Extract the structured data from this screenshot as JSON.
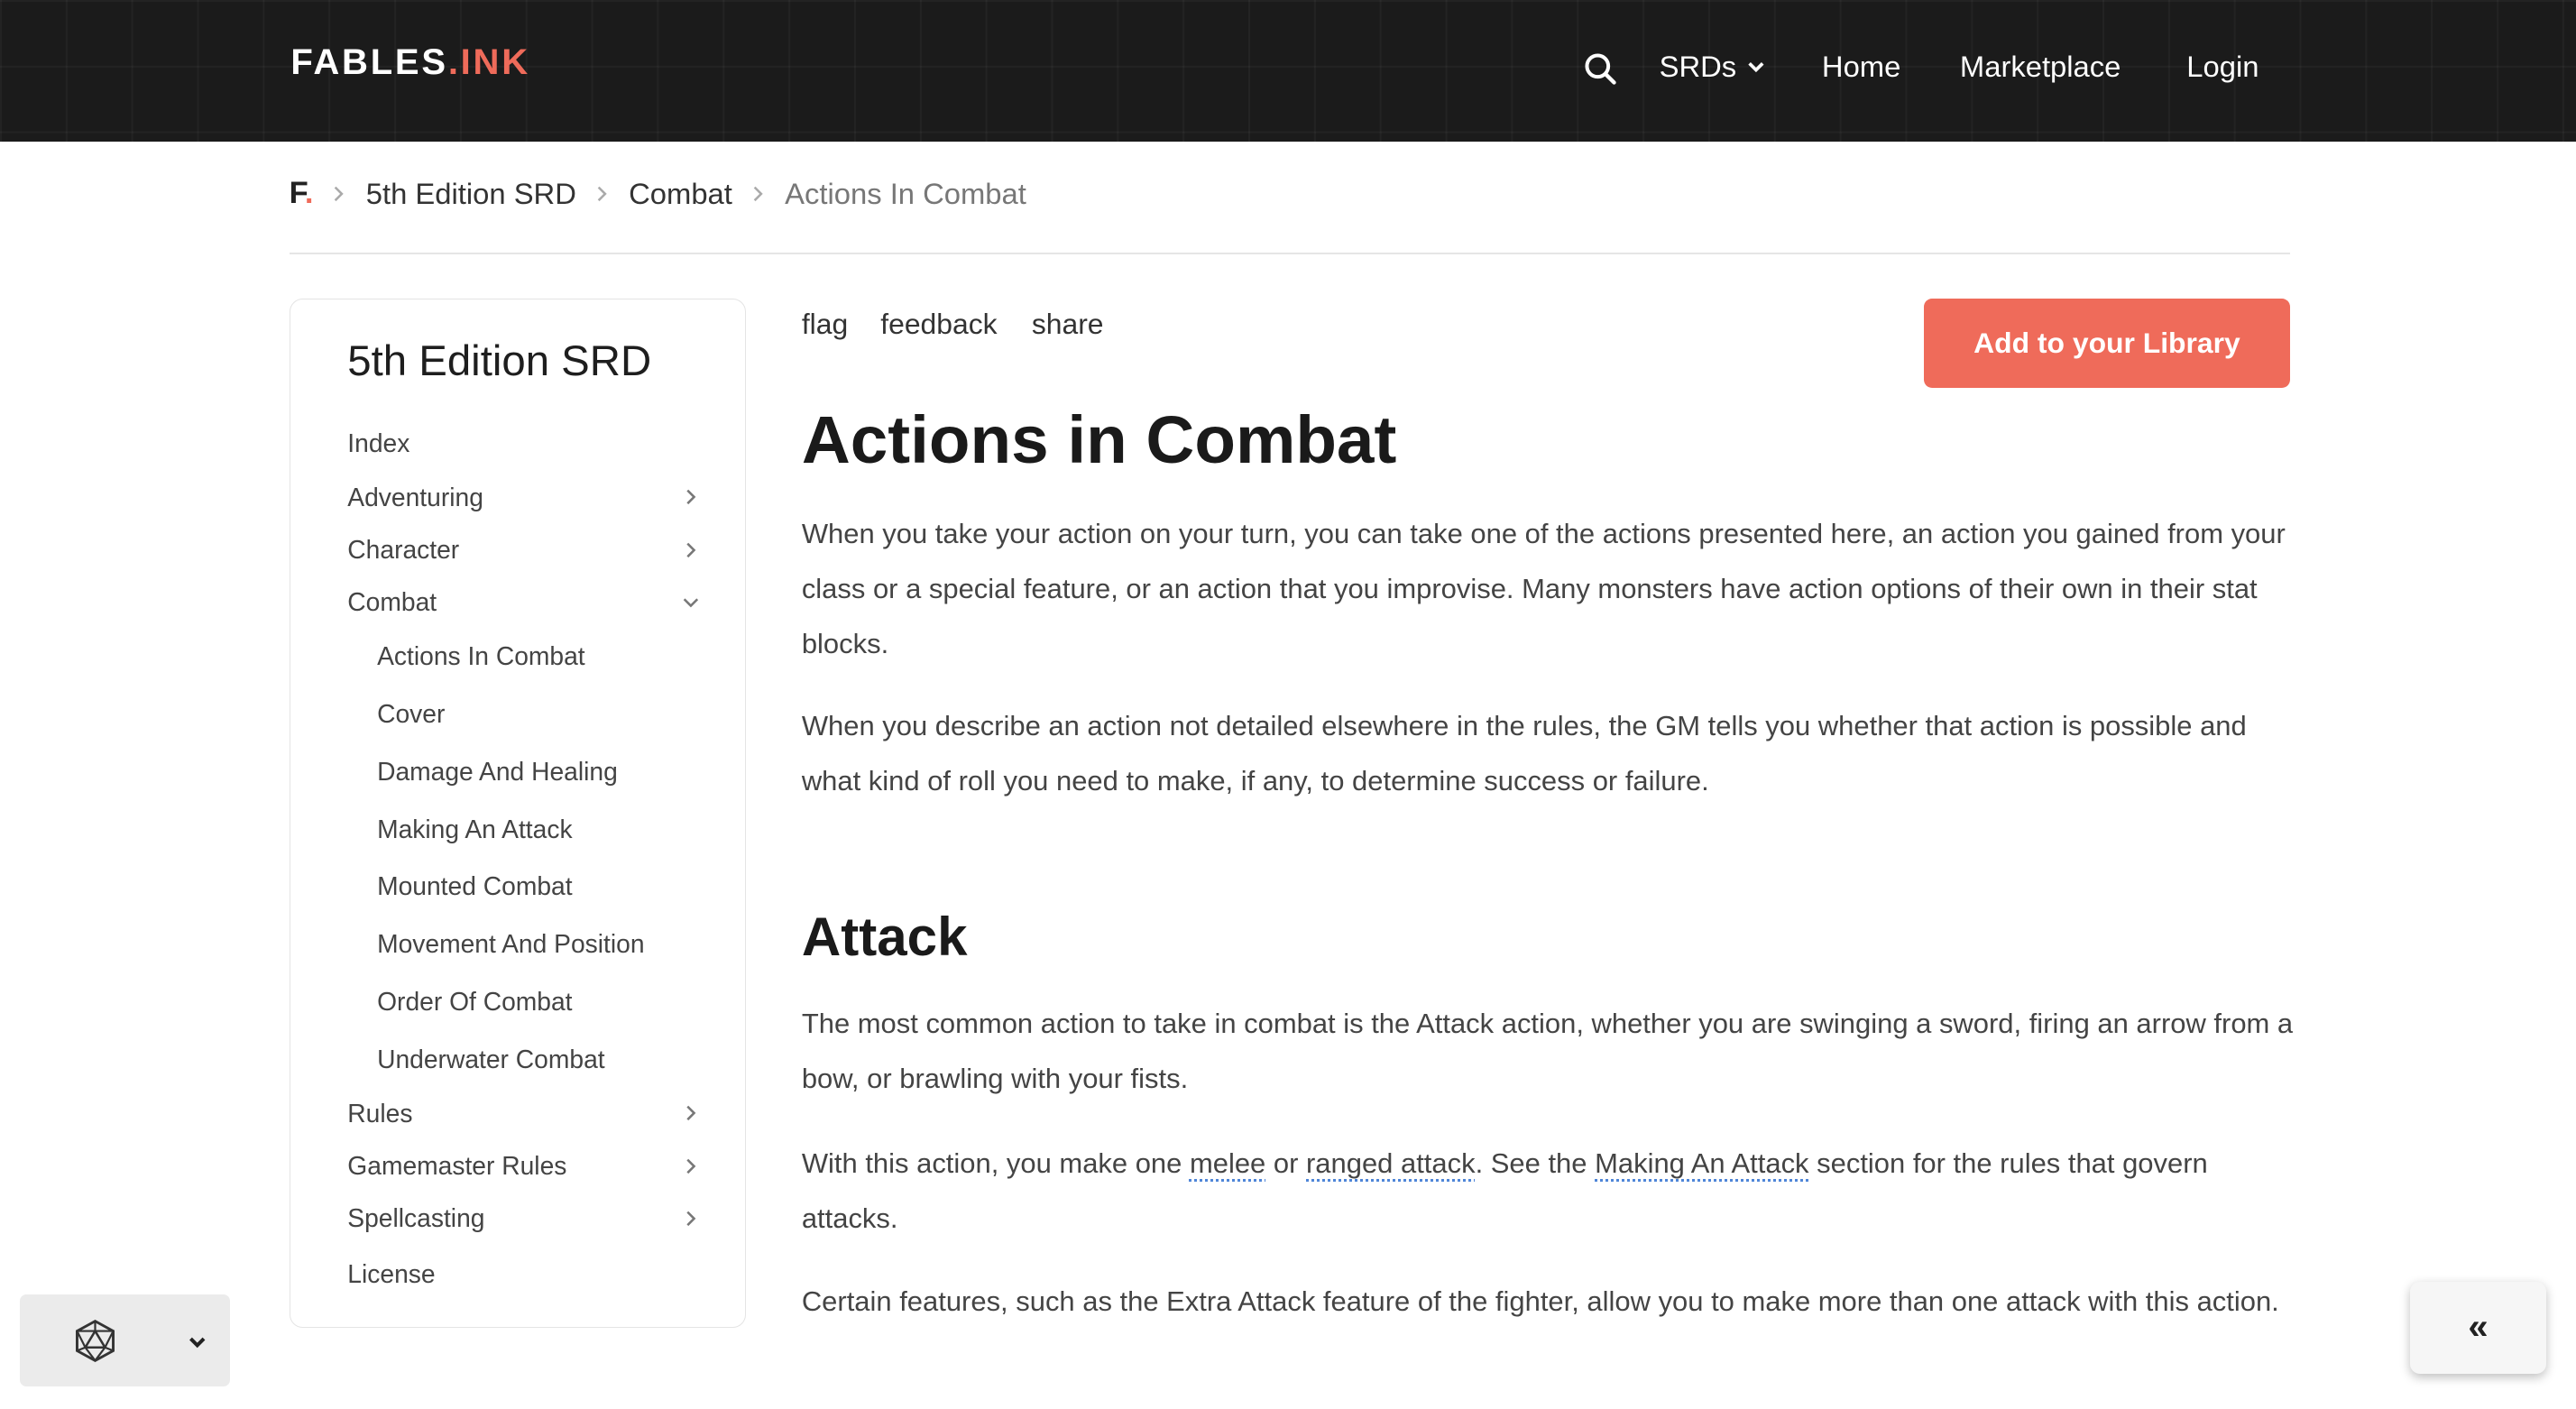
{
  "header": {
    "logo_main": "FABLES",
    "logo_accent": ".INK",
    "nav": {
      "srds": "SRDs",
      "home": "Home",
      "marketplace": "Marketplace",
      "login": "Login"
    }
  },
  "breadcrumb": {
    "home_letter": "F",
    "home_dot": ".",
    "items": [
      "5th Edition SRD",
      "Combat",
      "Actions In Combat"
    ]
  },
  "sidebar": {
    "title": "5th Edition SRD",
    "items": {
      "index": "Index",
      "adventuring": "Adventuring",
      "character": "Character",
      "combat": "Combat",
      "rules": "Rules",
      "gamemaster": "Gamemaster Rules",
      "spellcasting": "Spellcasting",
      "license": "License"
    },
    "combat_children": [
      "Actions In Combat",
      "Cover",
      "Damage And Healing",
      "Making An Attack",
      "Mounted Combat",
      "Movement And Position",
      "Order Of Combat",
      "Underwater Combat"
    ]
  },
  "main": {
    "actions": {
      "flag": "flag",
      "feedback": "feedback",
      "share": "share"
    },
    "library_button": "Add to your Library",
    "title": "Actions in Combat",
    "intro_p1": "When you take your action on your turn, you can take one of the actions presented here, an action you gained from your class or a special feature, or an action that you improvise. Many monsters have action options of their own in their stat blocks.",
    "intro_p2": "When you describe an action not detailed elsewhere in the rules, the GM tells you whether that action is possible and what kind of roll you need to make, if any, to determine success or failure.",
    "attack_heading": "Attack",
    "attack_p1": "The most common action to take in combat is the Attack action, whether you are swinging a sword, firing an arrow from a bow, or brawling with your fists.",
    "attack_p2": {
      "t1": "With this action, you make one ",
      "link1": "melee",
      "t2": " or ",
      "link2": "ranged attack",
      "t3": ". See the ",
      "link3": "Making An Attack",
      "t4": " section for the rules that govern attacks."
    },
    "attack_p3": "Certain features, such as the Extra Attack feature of the fighter, allow you to make more than one attack with this action."
  },
  "widgets": {
    "collapse_label": "«"
  },
  "colors": {
    "accent": "#ef6b5a",
    "header_bg": "#1b1b1b",
    "link_underline": "#4f86d8"
  }
}
